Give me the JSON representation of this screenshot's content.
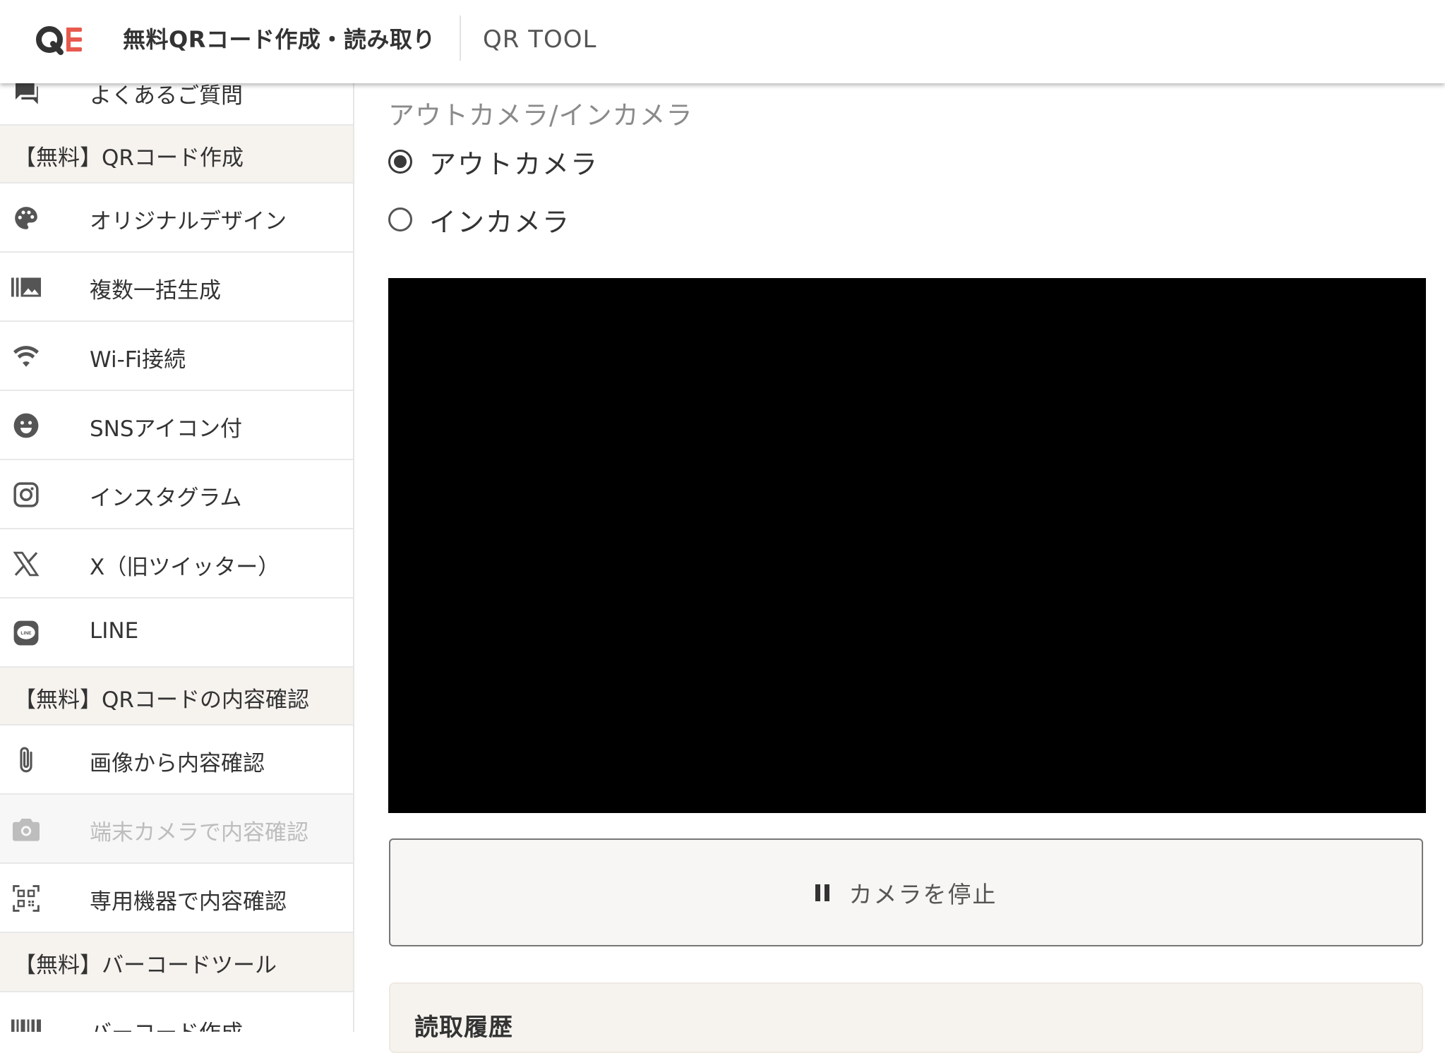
{
  "header": {
    "site_title": "無料QRコード作成・読み取り",
    "tool_name": "QR TOOL"
  },
  "sidebar": {
    "faq_label": "よくあるご質問",
    "section_create": "【無料】QRコード作成",
    "create_items": [
      {
        "label": "オリジナルデザイン",
        "icon": "palette-icon"
      },
      {
        "label": "複数一括生成",
        "icon": "image-stack-icon"
      },
      {
        "label": "Wi-Fi接続",
        "icon": "wifi-icon"
      },
      {
        "label": "SNSアイコン付",
        "icon": "smiley-icon"
      },
      {
        "label": "インスタグラム",
        "icon": "instagram-icon"
      },
      {
        "label": "X（旧ツイッター）",
        "icon": "x-icon"
      },
      {
        "label": "LINE",
        "icon": "line-icon"
      }
    ],
    "section_read": "【無料】QRコードの内容確認",
    "read_items": [
      {
        "label": "画像から内容確認",
        "icon": "paperclip-icon",
        "active": false
      },
      {
        "label": "端末カメラで内容確認",
        "icon": "camera-icon",
        "active": true
      },
      {
        "label": "専用機器で内容確認",
        "icon": "qr-scan-icon",
        "active": false
      }
    ],
    "section_barcode": "【無料】バーコードツール",
    "barcode_items": [
      {
        "label": "バーコード作成",
        "icon": "barcode-icon"
      }
    ]
  },
  "main": {
    "camera_legend": "アウトカメラ/インカメラ",
    "camera_options": [
      {
        "label": "アウトカメラ",
        "checked": true
      },
      {
        "label": "インカメラ",
        "checked": false
      }
    ],
    "stop_button_label": "カメラを停止",
    "history_title": "読取履歴"
  },
  "colors": {
    "logo_q": "#333333",
    "logo_e": "#e8594e",
    "section_bg": "#f6f3ef",
    "video_bg": "#000000"
  }
}
